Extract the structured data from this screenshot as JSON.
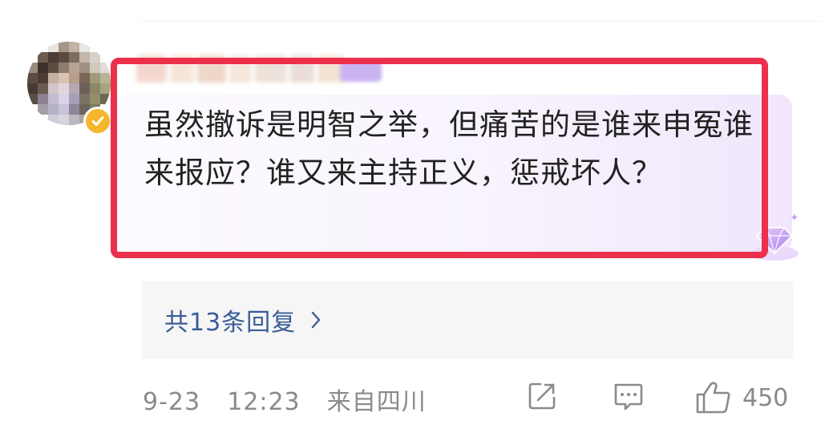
{
  "comment": {
    "author": {
      "avatar": "pixelated-avatar",
      "verified_badge": "verified-check-icon",
      "name_blurred": true
    },
    "text": "虽然撤诉是明智之举，但痛苦的是谁来申冤谁来报应？谁又来主持正义，惩戒坏人？",
    "highlight_color": "#ec2f4b"
  },
  "replies": {
    "label": "共13条回复",
    "icon": "chevron-right-icon",
    "color": "#3b5c96"
  },
  "footer": {
    "date": "9-23",
    "time": "12:23",
    "location": "来自四川",
    "share_icon": "share-icon",
    "comment_icon": "comment-icon",
    "like_icon": "thumbs-up-icon",
    "like_count": "450"
  }
}
